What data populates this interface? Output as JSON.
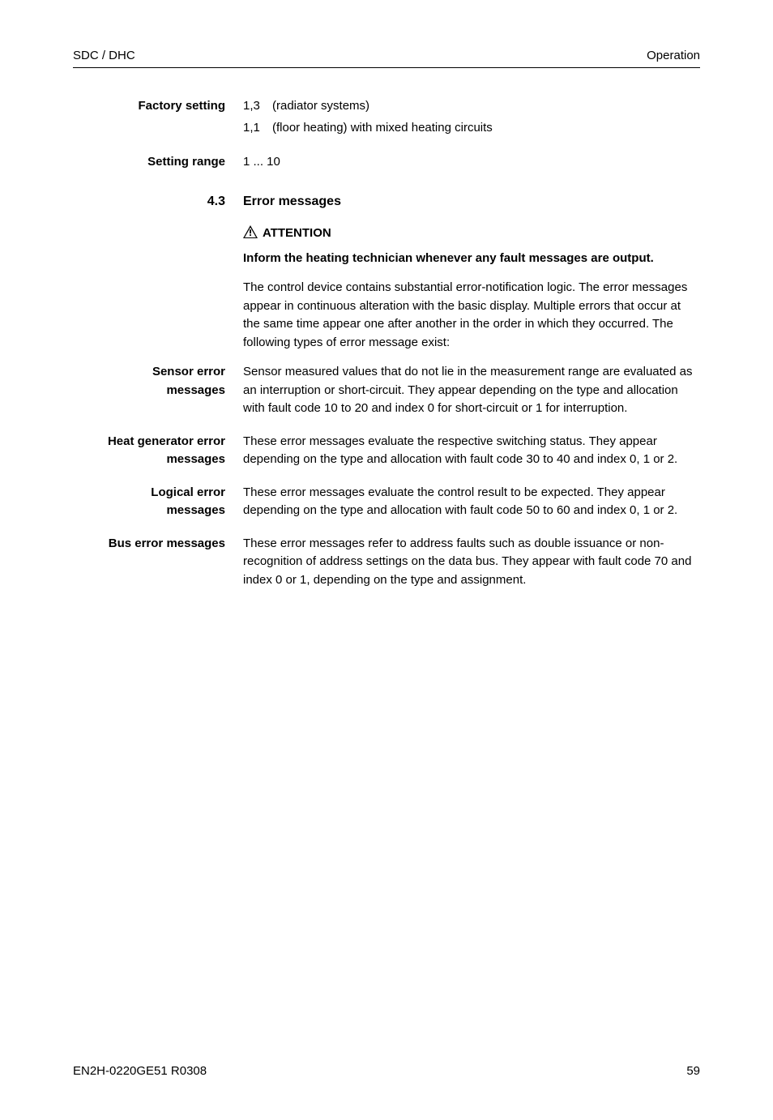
{
  "header": {
    "left": "SDC / DHC",
    "right": "Operation"
  },
  "factory_setting": {
    "label": "Factory setting",
    "items": [
      {
        "key": "1,3",
        "val": "(radiator systems)"
      },
      {
        "key": "1,1",
        "val": "(floor heating) with mixed heating circuits"
      }
    ]
  },
  "setting_range": {
    "label": "Setting range",
    "value": "1 ... 10"
  },
  "section": {
    "num": "4.3",
    "title": "Error messages"
  },
  "attention": {
    "label": "ATTENTION",
    "bold_text": "Inform the heating technician whenever any fault messages are output.",
    "body": "The control device contains substantial error-notification logic. The error messages appear in continuous alteration with the basic display. Multiple errors that occur at the same time appear one after another in the order in which they occurred. The following types of error message exist:"
  },
  "sensor_error": {
    "label_line1": "Sensor error",
    "label_line2": "messages",
    "body": "Sensor measured values that do not lie in the measurement range are evaluated as an interruption or short-circuit. They appear depending on the type and allocation with fault code 10 to 20 and index 0 for short-circuit or 1 for interruption."
  },
  "heat_gen_error": {
    "label_line1": "Heat generator error",
    "label_line2": "messages",
    "body": "These error messages evaluate the respective switching status. They appear depending on the type and allocation with fault code 30 to 40 and index 0, 1 or 2."
  },
  "logical_error": {
    "label_line1": "Logical error",
    "label_line2": "messages",
    "body": "These error messages evaluate the control result to be expected. They appear depending on the type and allocation with fault code 50 to 60 and index 0, 1 or 2."
  },
  "bus_error": {
    "label": "Bus error messages",
    "body": "These error messages refer to address faults such as double issuance or non-recognition of address settings on the data bus. They appear with fault code 70 and index 0 or 1, depending on the type and assignment."
  },
  "footer": {
    "left": "EN2H-0220GE51 R0308",
    "right": "59"
  }
}
